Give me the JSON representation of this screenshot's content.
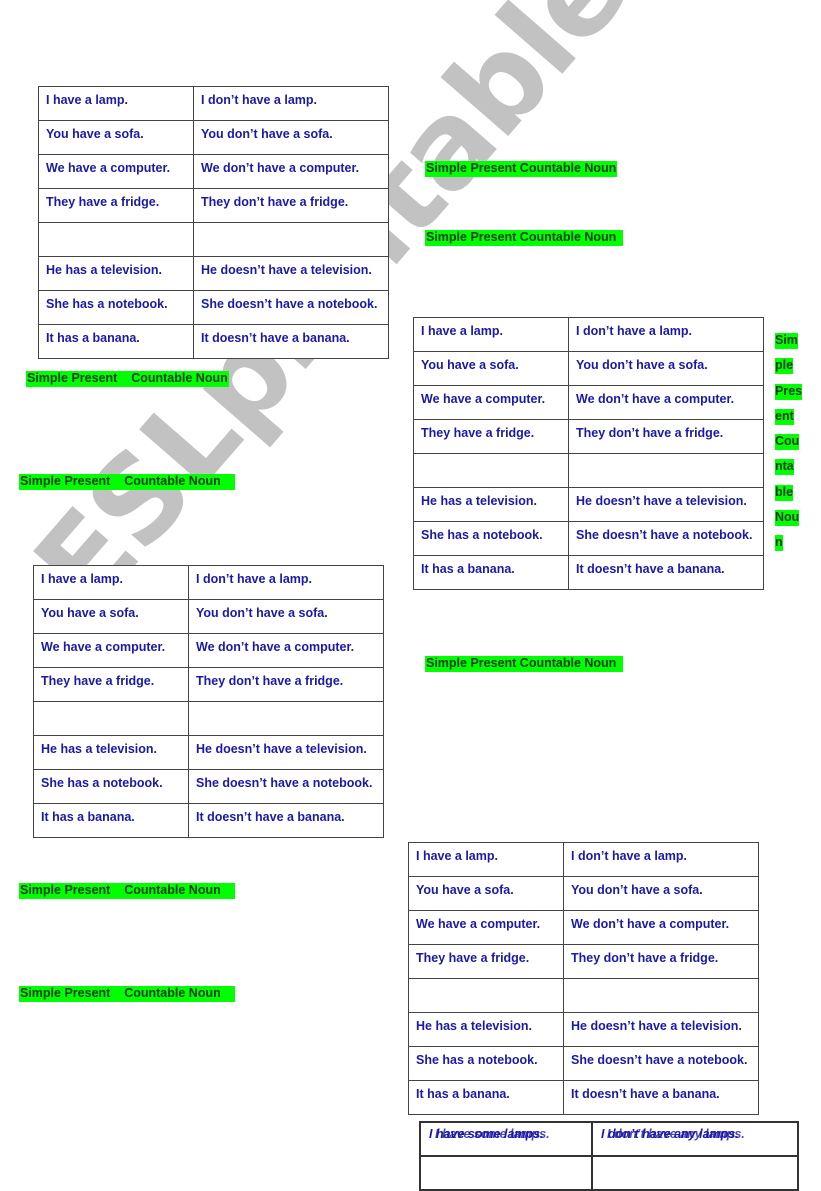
{
  "document": {
    "tables": [
      {
        "rows": [
          [
            "I have a lamp.",
            "I don’t have a lamp."
          ],
          [
            "You have a sofa.",
            "You don’t have a sofa."
          ],
          [
            "We have a computer.",
            "We don’t have a computer."
          ],
          [
            "They have a fridge.",
            "They don’t have a fridge."
          ],
          [
            "",
            ""
          ],
          [
            "He has a television.",
            "He doesn’t have a television."
          ],
          [
            "She has a notebook.",
            "She doesn’t have a notebook."
          ],
          [
            "It has a banana.",
            "It doesn’t have a banana."
          ]
        ]
      }
    ],
    "labels": {
      "spaced": "Simple Present    Countable Noun",
      "compact": "Simple Present Countable Noun",
      "compact_trailing": "Simple Present Countable Noun  ",
      "spaced_trailing": "Simple Present    Countable Noun    "
    },
    "vertical_label_fragments": [
      "Sim",
      "ple",
      "Pres",
      "ent",
      "Cou",
      "nta",
      "ble",
      "Nou",
      "n"
    ],
    "bottom_table": {
      "row": [
        "I have some lamps.",
        "I don’t have any lamps."
      ],
      "overlay": [
        "I have some lamps.",
        "I don’t have any lamps."
      ]
    },
    "watermark": "ESLprintables.com",
    "colors": {
      "highlight": "#00ff00",
      "text_blue": "#1a1aa6"
    }
  }
}
